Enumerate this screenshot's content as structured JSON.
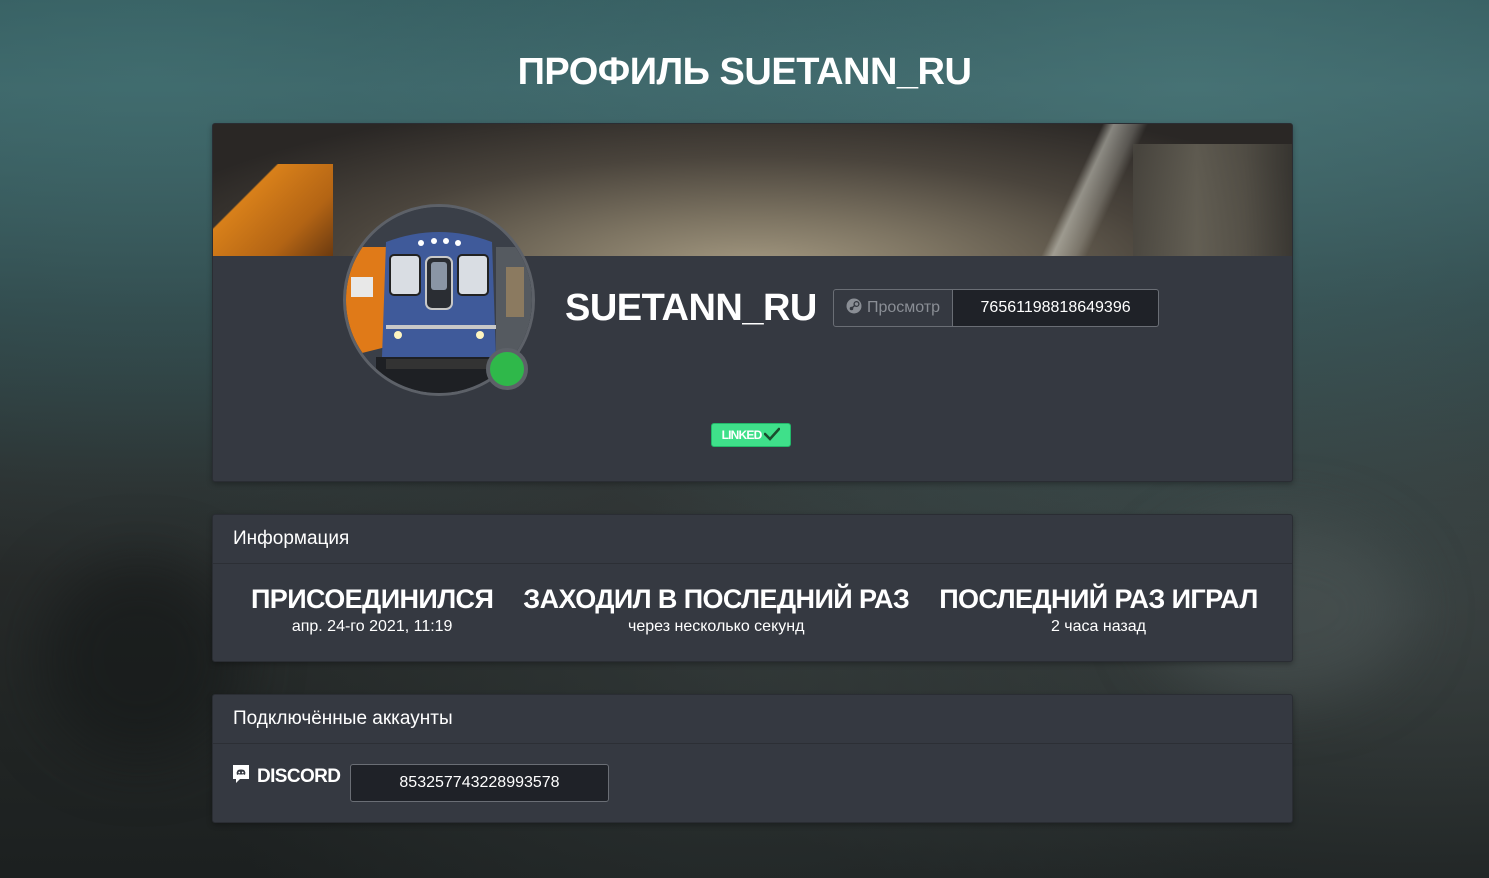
{
  "page": {
    "title": "ПРОФИЛЬ SUETANN_RU"
  },
  "profile": {
    "username": "SUETANN_RU",
    "status": "online",
    "status_color": "#2fb84a",
    "steam": {
      "view_label": "Просмотр",
      "view_icon": "steam-icon",
      "id": "76561198818649396"
    },
    "linked_badge": {
      "label": "LINKED",
      "icon": "check-icon",
      "color": "#3fe08a"
    }
  },
  "information": {
    "header": "Информация",
    "stats": [
      {
        "title": "ПРИСОЕДИНИЛСЯ",
        "value": "апр. 24-го 2021, 11:19"
      },
      {
        "title": "ЗАХОДИЛ В ПОСЛЕДНИЙ РАЗ",
        "value": "через несколько секунд"
      },
      {
        "title": "ПОСЛЕДНИЙ РАЗ ИГРАЛ",
        "value": "2 часа назад"
      }
    ]
  },
  "connected_accounts": {
    "header": "Подключённые аккаунты",
    "discord": {
      "icon": "discord-icon",
      "label": "DISCORD",
      "id": "853257743228993578"
    }
  }
}
